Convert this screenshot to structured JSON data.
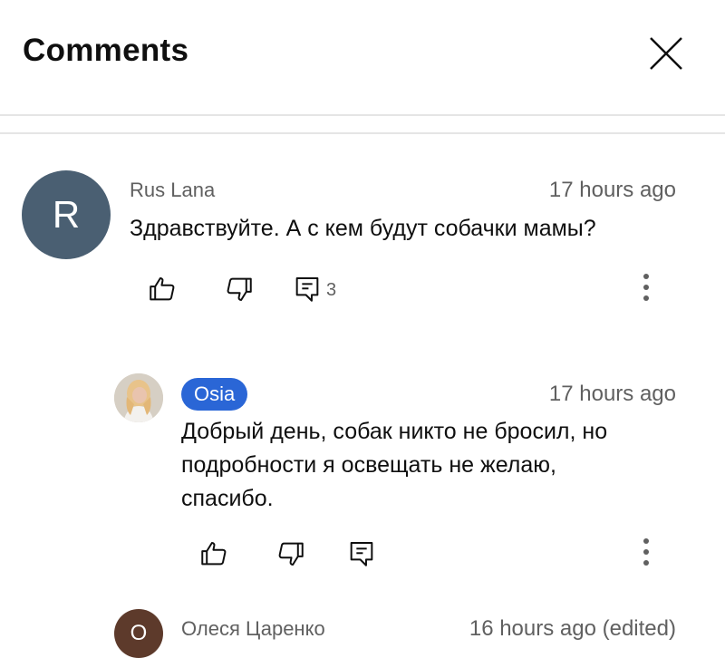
{
  "header": {
    "title": "Comments"
  },
  "comments": [
    {
      "author": "Rus Lana",
      "avatar_letter": "R",
      "avatar_color": "#4a5f72",
      "time": "17 hours ago",
      "text": "Здравствуйте. А с кем будут собачки мамы?",
      "reply_count": "3"
    },
    {
      "author": "Osia",
      "author_badge_color": "#2a66d6",
      "time": "17 hours ago",
      "text_lines": [
        "Добрый день, собак никто не бросил, но",
        "подробности я освещать не желаю,",
        "спасибо."
      ]
    },
    {
      "author": "Олеся Царенко",
      "avatar_letter": "О",
      "avatar_color": "#5d3a2b",
      "time": "16 hours ago (edited)"
    }
  ]
}
